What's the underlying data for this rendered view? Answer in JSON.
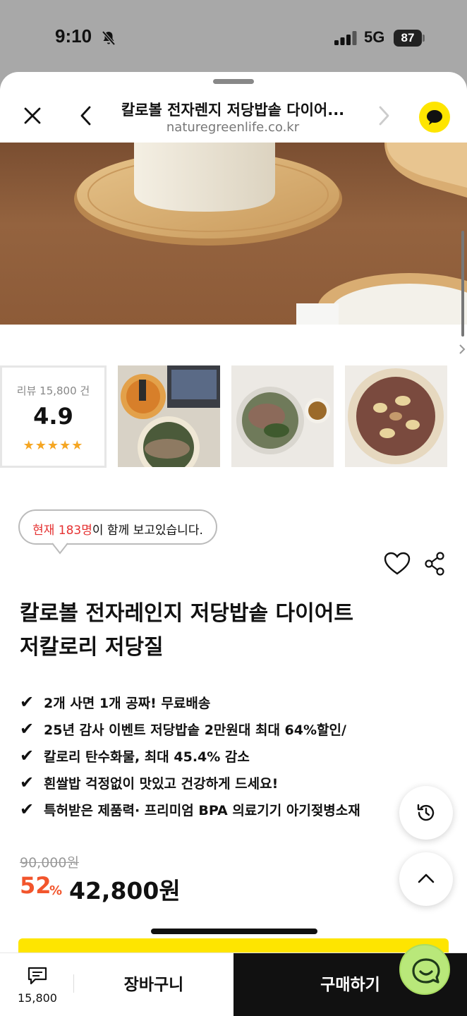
{
  "status_bar": {
    "time": "9:10",
    "network": "5G",
    "battery": "87"
  },
  "nav": {
    "title": "칼로볼 전자렌지 저당밥솥 다이어...",
    "url": "naturegreenlife.co.kr"
  },
  "carousel": {
    "page_count": 9,
    "active_index": 0
  },
  "review": {
    "label": "리뷰 15,800 건",
    "score": "4.9",
    "stars": "★★★★★"
  },
  "watchers": {
    "highlight": "현재 183명",
    "rest": "이 함께 보고있습니다."
  },
  "product": {
    "title_line1": "칼로볼 전자레인지 저당밥솥 다이어트",
    "title_line2": "저칼로리 저당질",
    "features": [
      "2개 사면 1개 공짜! 무료배송",
      "25년 감사 이벤트 저당밥솥 2만원대 최대 64%할인/",
      "칼로리 탄수화물, 최대 45.4% 감소",
      "흰쌀밥 걱정없이 맛있고 건강하게 드세요!",
      "특허받은 제품력· 프리미엄 BPA 의료기기 아기젖병소재"
    ],
    "check_mark": "✔",
    "original_price": "90,000원",
    "discount": "52",
    "discount_unit": "%",
    "sale_price": "42,800원"
  },
  "bottom_bar": {
    "review_count": "15,800",
    "cart_label": "장바구니",
    "buy_label": "구매하기"
  },
  "colors": {
    "kakao_yellow": "#fee500",
    "discount_red": "#f2552c",
    "highlight_red": "#e53232",
    "chat_green": "#b9e87a"
  },
  "icons": [
    "bell-slash-icon",
    "signal-icon",
    "close-icon",
    "back-icon",
    "forward-icon",
    "kakaotalk-icon",
    "heart-icon",
    "share-icon",
    "history-icon",
    "arrow-up-icon",
    "review-icon",
    "chat-icon"
  ]
}
